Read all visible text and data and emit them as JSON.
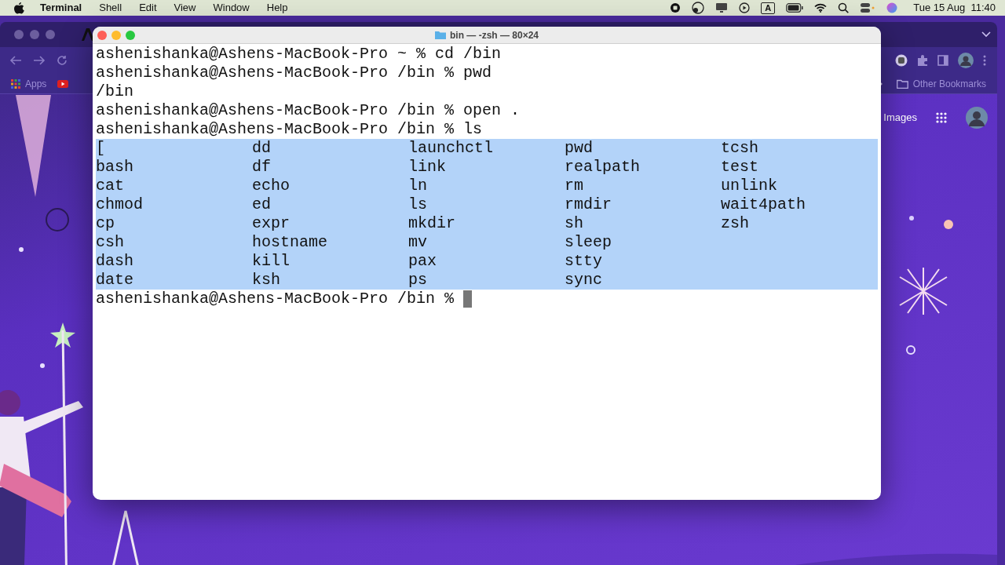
{
  "menu_bar": {
    "app": "Terminal",
    "menus": [
      "Shell",
      "Edit",
      "View",
      "Window",
      "Help"
    ],
    "input_source": "A",
    "clock": "Tue 15 Aug  11:40"
  },
  "browser": {
    "bookmarks": [
      "Apps"
    ],
    "other_bookmarks": "Other Bookmarks",
    "images_link": "Images"
  },
  "terminal": {
    "title": "bin — -zsh — 80×24",
    "lines": [
      "ashenishanka@Ashens-MacBook-Pro ~ % cd /bin",
      "ashenishanka@Ashens-MacBook-Pro /bin % pwd",
      "/bin",
      "ashenishanka@Ashens-MacBook-Pro /bin % open .",
      "ashenishanka@Ashens-MacBook-Pro /bin % ls"
    ],
    "listing": {
      "selected": true,
      "columns": [
        [
          "[",
          "bash",
          "cat",
          "chmod",
          "cp",
          "csh",
          "dash",
          "date"
        ],
        [
          "dd",
          "df",
          "echo",
          "ed",
          "expr",
          "hostname",
          "kill",
          "ksh"
        ],
        [
          "launchctl",
          "link",
          "ln",
          "ls",
          "mkdir",
          "mv",
          "pax",
          "ps"
        ],
        [
          "pwd",
          "realpath",
          "rm",
          "rmdir",
          "sh",
          "sleep",
          "stty",
          "sync"
        ],
        [
          "tcsh",
          "test",
          "unlink",
          "wait4path",
          "zsh"
        ]
      ]
    },
    "prompt": "ashenishanka@Ashens-MacBook-Pro /bin %",
    "cursor": true
  }
}
